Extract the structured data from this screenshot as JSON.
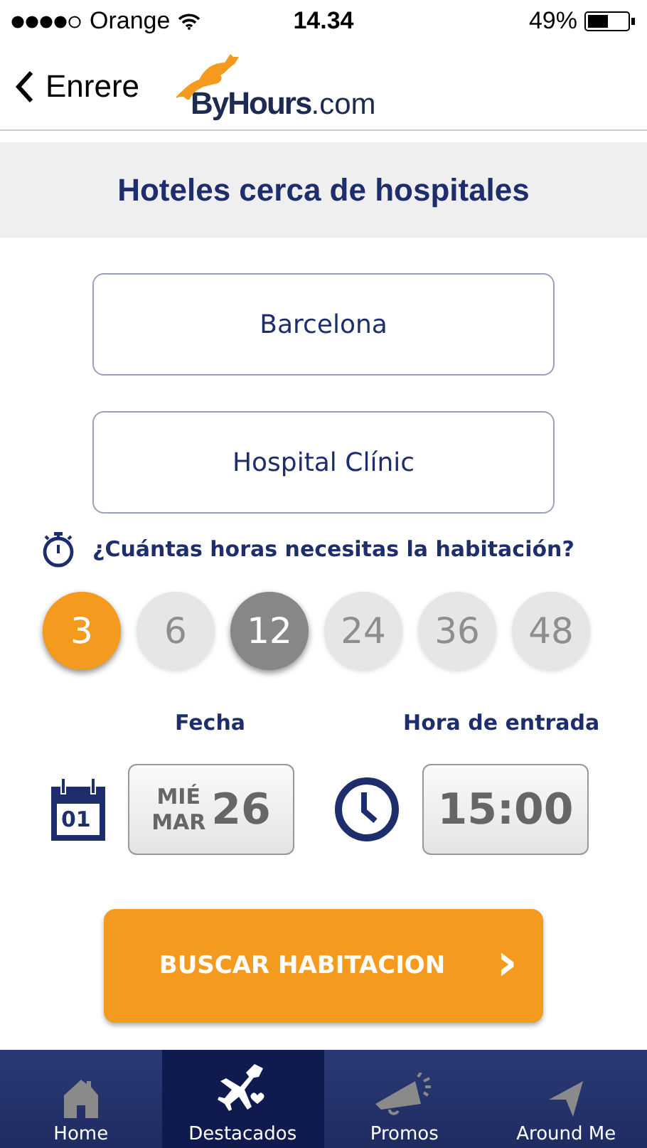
{
  "status_bar": {
    "carrier": "Orange",
    "time": "14.34",
    "battery": "49%"
  },
  "nav": {
    "back": "Enrere",
    "logo": {
      "brand": "ByHours",
      "suffix": ".com"
    }
  },
  "title": "Hoteles cerca de hospitales",
  "fields": [
    {
      "value": "Barcelona"
    },
    {
      "value": "Hospital Clínic"
    }
  ],
  "question": "¿Cuántas horas necesitas la habitación?",
  "hours": [
    {
      "label": "3",
      "selected": true,
      "disabled": false
    },
    {
      "label": "6",
      "selected": false,
      "disabled": true
    },
    {
      "label": "12",
      "selected": false,
      "disabled": false
    },
    {
      "label": "24",
      "selected": false,
      "disabled": true
    },
    {
      "label": "36",
      "selected": false,
      "disabled": true
    },
    {
      "label": "48",
      "selected": false,
      "disabled": true
    }
  ],
  "date": {
    "label": "Fecha",
    "weekday": "MIÉ",
    "month": "MAR",
    "day": "26",
    "calendar_icon_text": "01"
  },
  "time": {
    "label": "Hora de entrada",
    "value": "15:00"
  },
  "search_button": {
    "label": "BUSCAR HABITACION",
    "chevron": "›"
  },
  "tabs": [
    {
      "label": "Home",
      "kind": "home",
      "selected": false
    },
    {
      "label": "Destacados",
      "kind": "featured",
      "selected": true
    },
    {
      "label": "Promos",
      "kind": "promos",
      "selected": false
    },
    {
      "label": "Around Me",
      "kind": "around",
      "selected": false
    }
  ]
}
